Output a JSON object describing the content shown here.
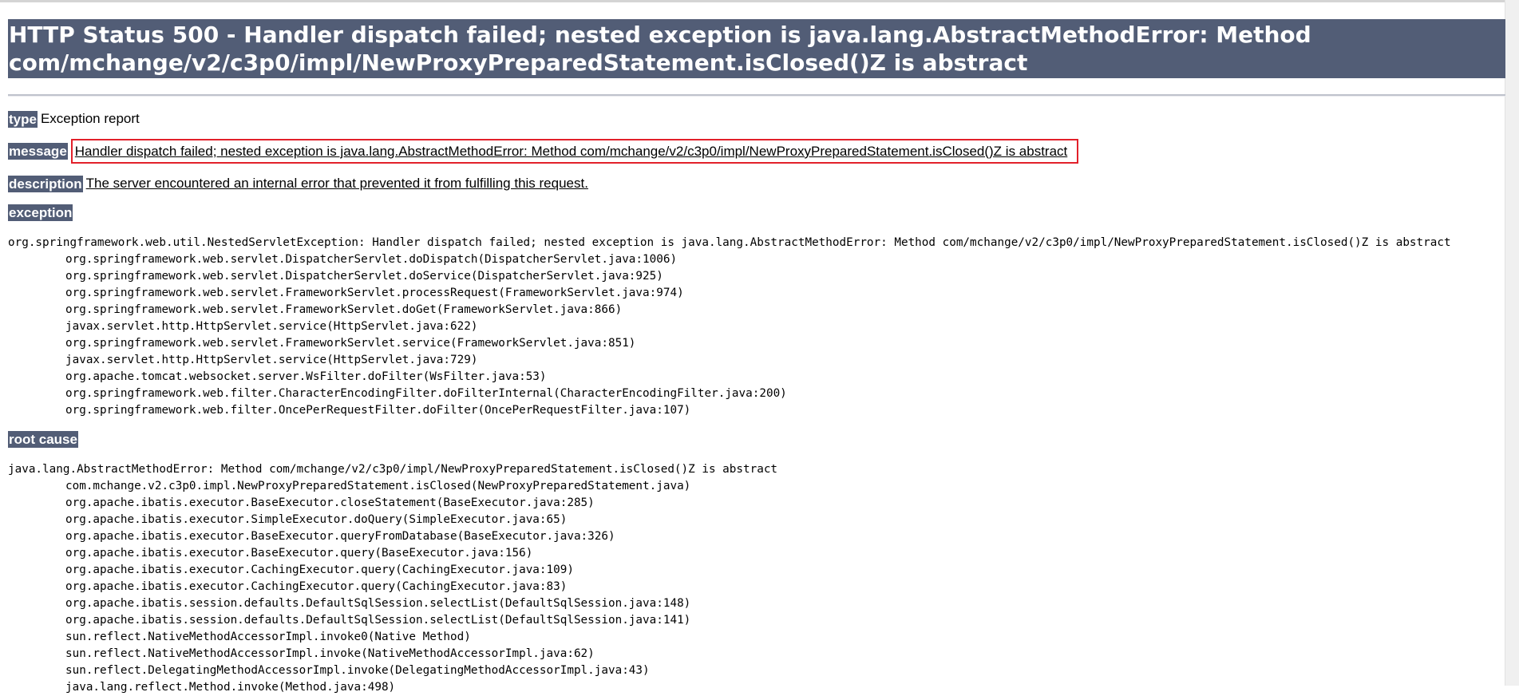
{
  "title": "HTTP Status 500 - Handler dispatch failed; nested exception is java.lang.AbstractMethodError: Method com/mchange/v2/c3p0/impl/NewProxyPreparedStatement.isClosed()Z is abstract",
  "type_label": "type",
  "type_value": "Exception report",
  "message_label": "message",
  "message_value": "Handler dispatch failed; nested exception is java.lang.AbstractMethodError: Method com/mchange/v2/c3p0/impl/NewProxyPreparedStatement.isClosed()Z is abstract",
  "description_label": "description",
  "description_value": "The server encountered an internal error that prevented it from fulfilling this request.",
  "exception_label": "exception",
  "exception_head": "org.springframework.web.util.NestedServletException: Handler dispatch failed; nested exception is java.lang.AbstractMethodError: Method com/mchange/v2/c3p0/impl/NewProxyPreparedStatement.isClosed()Z is abstract",
  "exception_frames": [
    "org.springframework.web.servlet.DispatcherServlet.doDispatch(DispatcherServlet.java:1006)",
    "org.springframework.web.servlet.DispatcherServlet.doService(DispatcherServlet.java:925)",
    "org.springframework.web.servlet.FrameworkServlet.processRequest(FrameworkServlet.java:974)",
    "org.springframework.web.servlet.FrameworkServlet.doGet(FrameworkServlet.java:866)",
    "javax.servlet.http.HttpServlet.service(HttpServlet.java:622)",
    "org.springframework.web.servlet.FrameworkServlet.service(FrameworkServlet.java:851)",
    "javax.servlet.http.HttpServlet.service(HttpServlet.java:729)",
    "org.apache.tomcat.websocket.server.WsFilter.doFilter(WsFilter.java:53)",
    "org.springframework.web.filter.CharacterEncodingFilter.doFilterInternal(CharacterEncodingFilter.java:200)",
    "org.springframework.web.filter.OncePerRequestFilter.doFilter(OncePerRequestFilter.java:107)"
  ],
  "root_cause_label": "root cause",
  "root_cause_head": "java.lang.AbstractMethodError: Method com/mchange/v2/c3p0/impl/NewProxyPreparedStatement.isClosed()Z is abstract",
  "root_cause_frames": [
    "com.mchange.v2.c3p0.impl.NewProxyPreparedStatement.isClosed(NewProxyPreparedStatement.java)",
    "org.apache.ibatis.executor.BaseExecutor.closeStatement(BaseExecutor.java:285)",
    "org.apache.ibatis.executor.SimpleExecutor.doQuery(SimpleExecutor.java:65)",
    "org.apache.ibatis.executor.BaseExecutor.queryFromDatabase(BaseExecutor.java:326)",
    "org.apache.ibatis.executor.BaseExecutor.query(BaseExecutor.java:156)",
    "org.apache.ibatis.executor.CachingExecutor.query(CachingExecutor.java:109)",
    "org.apache.ibatis.executor.CachingExecutor.query(CachingExecutor.java:83)",
    "org.apache.ibatis.session.defaults.DefaultSqlSession.selectList(DefaultSqlSession.java:148)",
    "org.apache.ibatis.session.defaults.DefaultSqlSession.selectList(DefaultSqlSession.java:141)",
    "sun.reflect.NativeMethodAccessorImpl.invoke0(Native Method)",
    "sun.reflect.NativeMethodAccessorImpl.invoke(NativeMethodAccessorImpl.java:62)",
    "sun.reflect.DelegatingMethodAccessorImpl.invoke(DelegatingMethodAccessorImpl.java:43)",
    "java.lang.reflect.Method.invoke(Method.java:498)"
  ],
  "colors": {
    "header_bg": "#525d76",
    "header_text": "#ffffff",
    "highlight_border": "#e2202a"
  }
}
